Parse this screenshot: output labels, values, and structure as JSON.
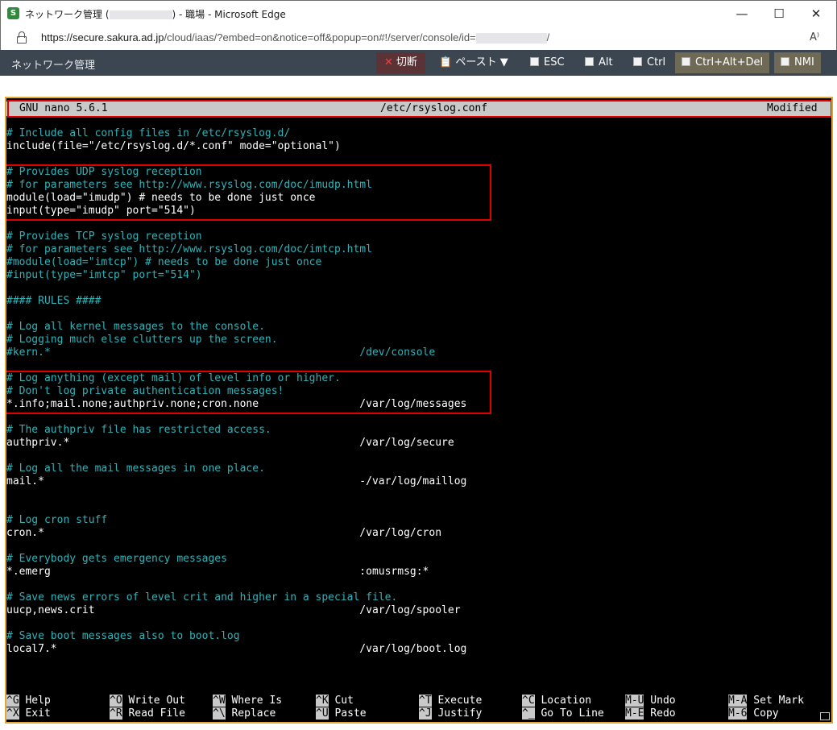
{
  "window": {
    "title_prefix": "ネットワーク管理 (",
    "title_suffix": ") - 職場 - Microsoft Edge",
    "app_icon_label": "S",
    "controls": {
      "minimize": "—",
      "maximize": "☐",
      "close": "✕"
    }
  },
  "address": {
    "url_host": "https://secure.sakura.ad.jp",
    "url_path": "/cloud/iaas/?embed=on&notice=off&popup=on#!/server/console/id=",
    "url_end": "/",
    "reader_icon": "A⁾"
  },
  "toolbar": {
    "title": "ネットワーク管理",
    "disconnect": "切断",
    "disconnect_icon": "✕",
    "paste": "ペースト ▼",
    "paste_icon": "📋",
    "esc": "ESC",
    "alt": "Alt",
    "ctrl": "Ctrl",
    "ctrl_alt_del": "Ctrl+Alt+Del",
    "nmi": "NMI"
  },
  "nano": {
    "version": "GNU nano 5.6.1",
    "filename": "/etc/rsyslog.conf",
    "status": "Modified"
  },
  "lines": [
    "# Include all config files in /etc/rsyslog.d/",
    "include(file=\"/etc/rsyslog.d/*.conf\" mode=\"optional\")",
    "",
    "# Provides UDP syslog reception",
    "# for parameters see http://www.rsyslog.com/doc/imudp.html",
    "module(load=\"imudp\") # needs to be done just once",
    "input(type=\"imudp\" port=\"514\")",
    "",
    "# Provides TCP syslog reception",
    "# for parameters see http://www.rsyslog.com/doc/imtcp.html",
    "#module(load=\"imtcp\") # needs to be done just once",
    "#input(type=\"imtcp\" port=\"514\")",
    "",
    "#### RULES ####",
    "",
    "# Log all kernel messages to the console.",
    "# Logging much else clutters up the screen.",
    "#kern.*                                                 /dev/console",
    "",
    "# Log anything (except mail) of level info or higher.",
    "# Don't log private authentication messages!",
    "*.info;mail.none;authpriv.none;cron.none                /var/log/messages",
    "",
    "# The authpriv file has restricted access.",
    "authpriv.*                                              /var/log/secure",
    "",
    "# Log all the mail messages in one place.",
    "mail.*                                                  -/var/log/maillog",
    "",
    "",
    "# Log cron stuff",
    "cron.*                                                  /var/log/cron",
    "",
    "# Everybody gets emergency messages",
    "*.emerg                                                 :omusrmsg:*",
    "",
    "# Save news errors of level crit and higher in a special file.",
    "uucp,news.crit                                          /var/log/spooler",
    "",
    "# Save boot messages also to boot.log",
    "local7.*                                                /var/log/boot.log"
  ],
  "comment_lines": [
    0,
    3,
    4,
    8,
    9,
    10,
    11,
    13,
    15,
    16,
    17,
    19,
    20,
    23,
    26,
    30,
    33,
    36,
    39
  ],
  "shortcuts": [
    {
      "key": "^G",
      "label": "Help"
    },
    {
      "key": "^X",
      "label": "Exit"
    },
    {
      "key": "^O",
      "label": "Write Out"
    },
    {
      "key": "^R",
      "label": "Read File"
    },
    {
      "key": "^W",
      "label": "Where Is"
    },
    {
      "key": "^\\",
      "label": "Replace"
    },
    {
      "key": "^K",
      "label": "Cut"
    },
    {
      "key": "^U",
      "label": "Paste"
    },
    {
      "key": "^T",
      "label": "Execute"
    },
    {
      "key": "^J",
      "label": "Justify"
    },
    {
      "key": "^C",
      "label": "Location"
    },
    {
      "key": "^_",
      "label": "Go To Line"
    },
    {
      "key": "M-U",
      "label": "Undo"
    },
    {
      "key": "M-E",
      "label": "Redo"
    },
    {
      "key": "M-A",
      "label": "Set Mark"
    },
    {
      "key": "M-6",
      "label": "Copy"
    }
  ],
  "colors": {
    "comment": "#2fb3b8",
    "text": "#ffffff",
    "highlight": "#e00000",
    "terminal_border": "#e0a93a"
  }
}
